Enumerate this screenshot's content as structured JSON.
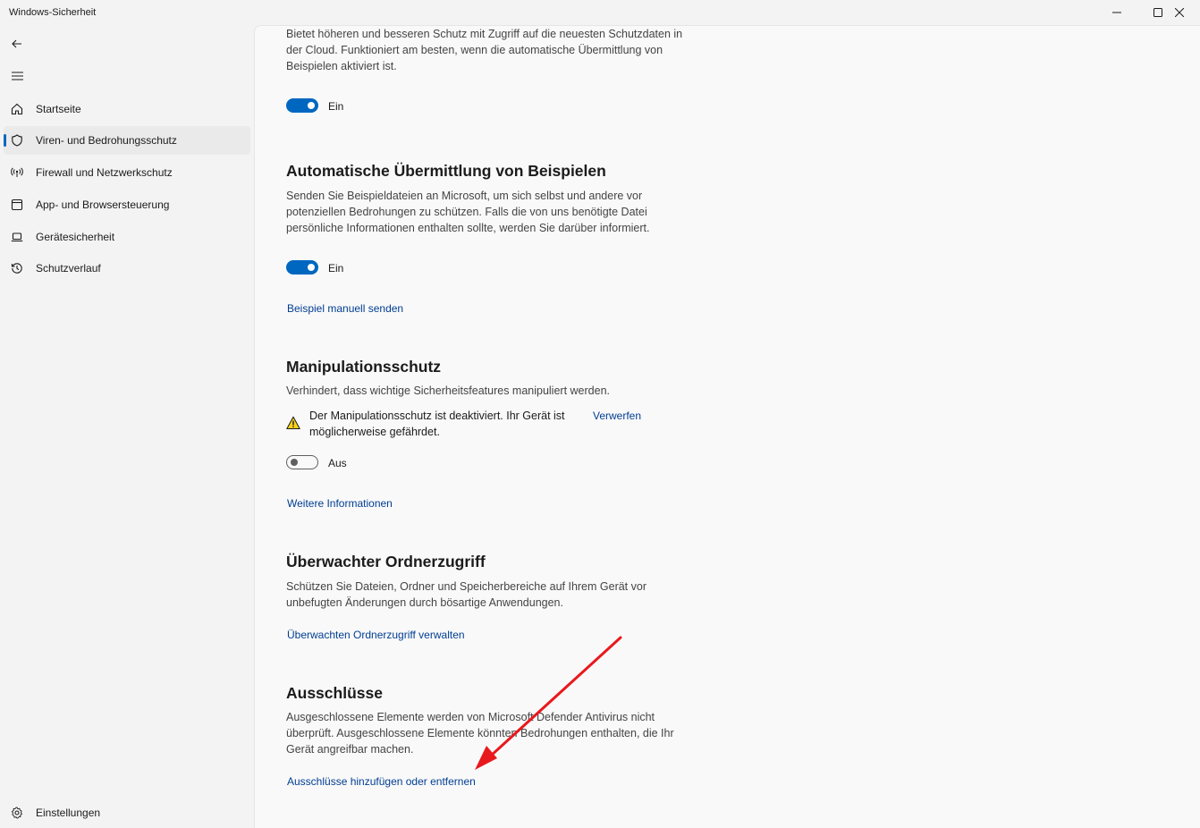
{
  "window": {
    "title": "Windows-Sicherheit",
    "minimize_icon": "minimize-icon",
    "maximize_icon": "maximize-icon",
    "close_icon": "close-icon"
  },
  "nav": {
    "back_icon": "back-arrow-icon",
    "menu_icon": "hamburger-menu-icon",
    "items": [
      {
        "label": "Startseite",
        "icon": "home-icon",
        "selected": false
      },
      {
        "label": "Viren- und Bedrohungsschutz",
        "icon": "shield-icon",
        "selected": true
      },
      {
        "label": "Firewall und Netzwerkschutz",
        "icon": "wireless-antenna-icon",
        "selected": false
      },
      {
        "label": "App- und Browsersteuerung",
        "icon": "app-window-icon",
        "selected": false
      },
      {
        "label": "Gerätesicherheit",
        "icon": "laptop-icon",
        "selected": false
      },
      {
        "label": "Schutzverlauf",
        "icon": "history-icon",
        "selected": false
      }
    ],
    "settings": {
      "label": "Einstellungen",
      "icon": "gear-icon"
    }
  },
  "accent_color": "#0067c0",
  "link_color": "#003e92",
  "cloud_protection": {
    "description": "Bietet höheren und besseren Schutz mit Zugriff auf die neuesten Schutzdaten in der Cloud. Funktioniert am besten, wenn die automatische Übermittlung von Beispielen aktiviert ist.",
    "toggle_state": "Ein"
  },
  "sample_submission": {
    "title": "Automatische Übermittlung von Beispielen",
    "description": "Senden Sie Beispieldateien an Microsoft, um sich selbst und andere vor potenziellen Bedrohungen zu schützen. Falls die von uns benötigte Datei persönliche Informationen enthalten sollte, werden Sie darüber informiert.",
    "toggle_state": "Ein",
    "link": "Beispiel manuell senden"
  },
  "tamper_protection": {
    "title": "Manipulationsschutz",
    "description": "Verhindert, dass wichtige Sicherheitsfeatures manipuliert werden.",
    "warning_icon": "warning-triangle-icon",
    "warning": "Der Manipulationsschutz ist deaktiviert. Ihr Gerät ist möglicherweise gefährdet.",
    "dismiss": "Verwerfen",
    "toggle_state": "Aus",
    "link": "Weitere Informationen"
  },
  "folder_access": {
    "title": "Überwachter Ordnerzugriff",
    "description": "Schützen Sie Dateien, Ordner und Speicherbereiche auf Ihrem Gerät vor unbefugten Änderungen durch bösartige Anwendungen.",
    "link": "Überwachten Ordnerzugriff verwalten"
  },
  "exclusions": {
    "title": "Ausschlüsse",
    "description": "Ausgeschlossene Elemente werden von Microsoft Defender Antivirus nicht überprüft. Ausgeschlossene Elemente könnten Bedrohungen enthalten, die Ihr Gerät angreifbar machen.",
    "link": "Ausschlüsse hinzufügen oder entfernen"
  },
  "annotation": {
    "type": "red-arrow",
    "color": "#e8191d"
  }
}
